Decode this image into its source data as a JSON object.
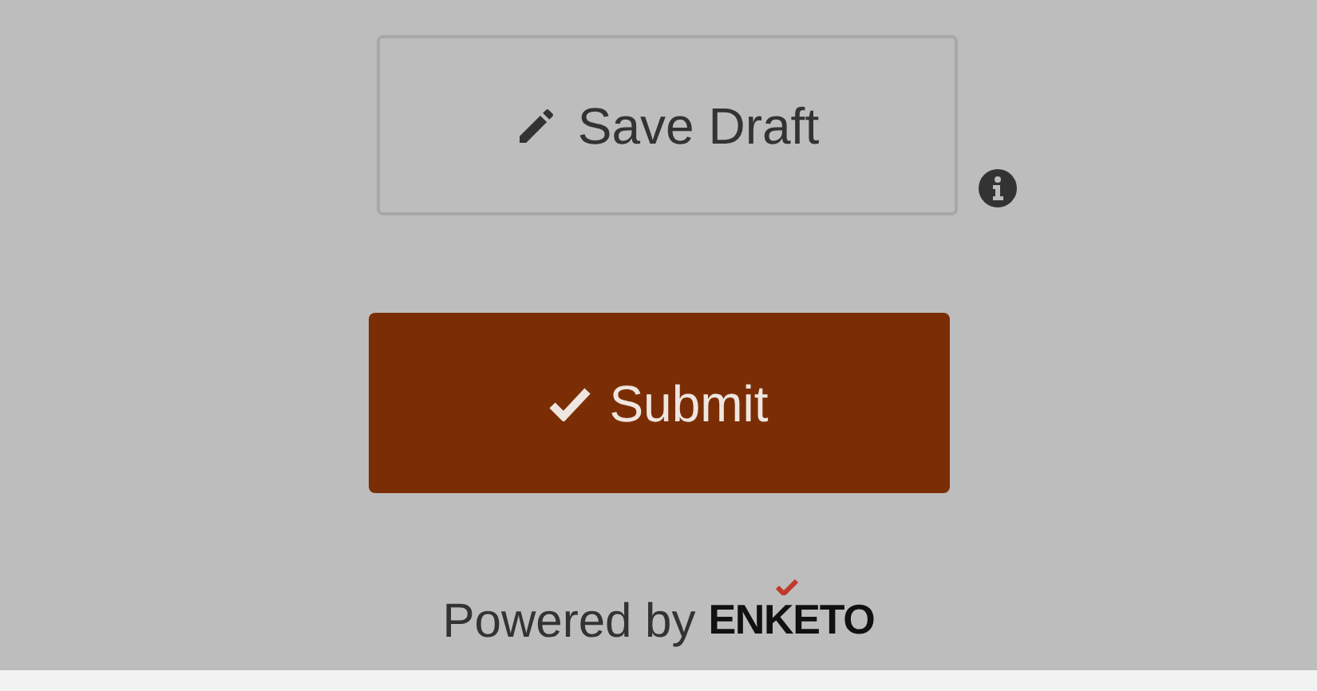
{
  "save_draft_button": {
    "label": "Save Draft"
  },
  "submit_button": {
    "label": "Submit"
  },
  "footer": {
    "text": "Powered by",
    "logo": "ENKETO"
  }
}
